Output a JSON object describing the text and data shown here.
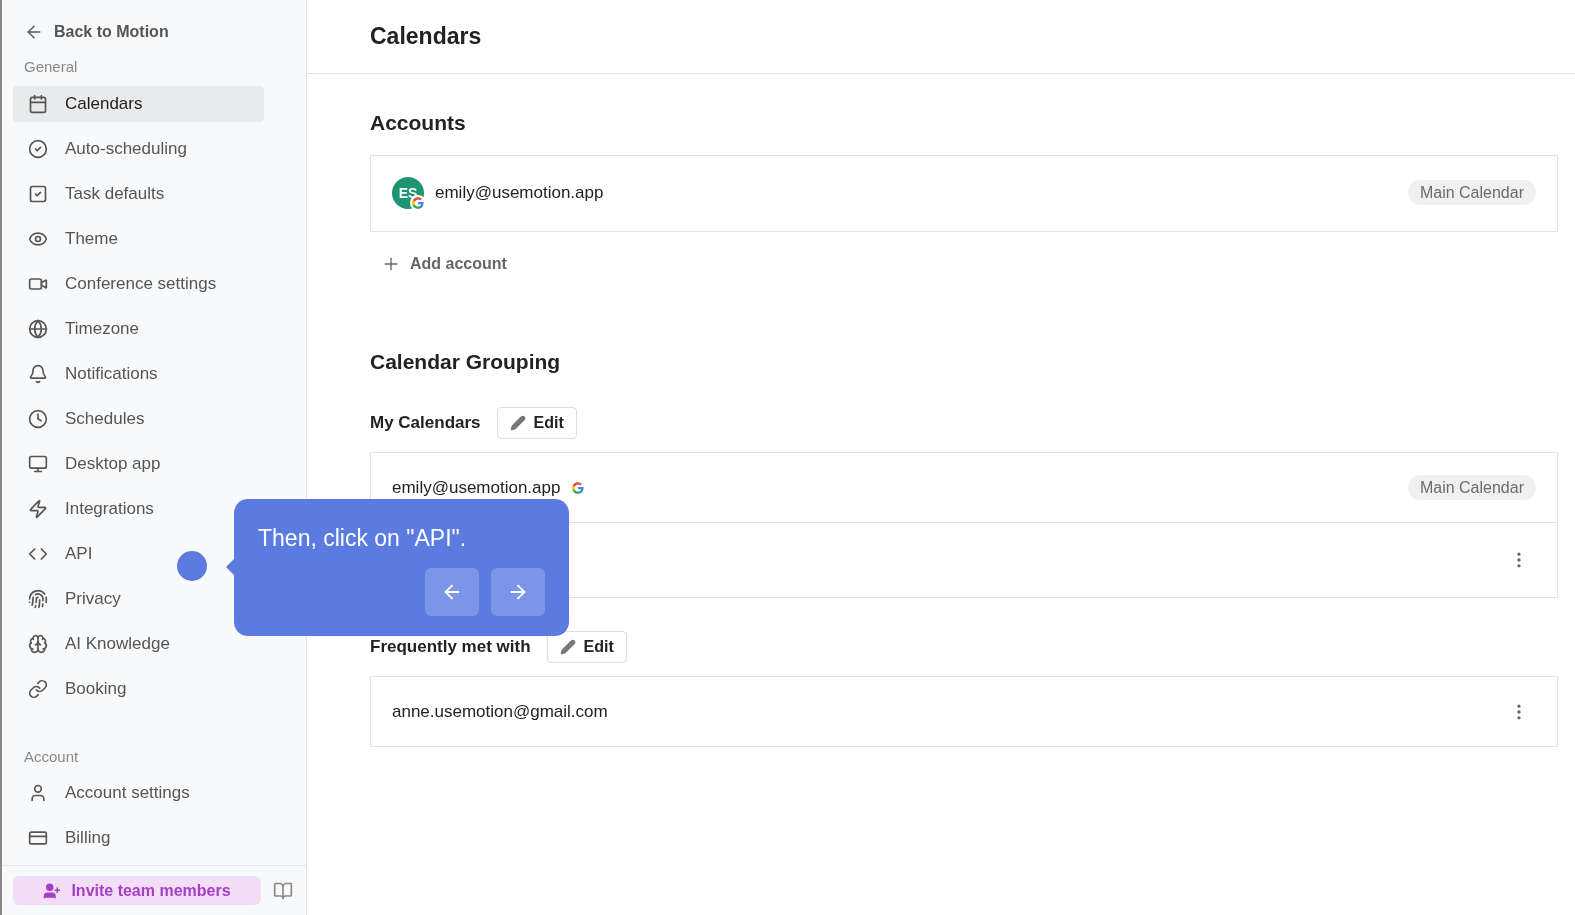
{
  "sidebar": {
    "back_link": "Back to Motion",
    "sections": [
      {
        "title": "General",
        "items": [
          {
            "label": "Calendars",
            "selected": true
          },
          {
            "label": "Auto-scheduling",
            "selected": false
          },
          {
            "label": "Task defaults",
            "selected": false
          },
          {
            "label": "Theme",
            "selected": false
          },
          {
            "label": "Conference settings",
            "selected": false
          },
          {
            "label": "Timezone",
            "selected": false
          },
          {
            "label": "Notifications",
            "selected": false
          },
          {
            "label": "Schedules",
            "selected": false
          },
          {
            "label": "Desktop app",
            "selected": false
          },
          {
            "label": "Integrations",
            "selected": false
          },
          {
            "label": "API",
            "selected": false
          },
          {
            "label": "Privacy",
            "selected": false
          },
          {
            "label": "AI Knowledge",
            "selected": false
          },
          {
            "label": "Booking",
            "selected": false
          }
        ]
      },
      {
        "title": "Account",
        "items": [
          {
            "label": "Account settings",
            "selected": false
          },
          {
            "label": "Billing",
            "selected": false
          }
        ]
      }
    ],
    "invite_button": "Invite team members"
  },
  "main": {
    "title": "Calendars",
    "accounts": {
      "heading": "Accounts",
      "items": [
        {
          "initials": "ES",
          "email": "emily@usemotion.app",
          "badge": "Main Calendar"
        }
      ],
      "add_button": "Add account"
    },
    "grouping": {
      "heading": "Calendar Grouping",
      "groups": [
        {
          "title": "My Calendars",
          "edit_button": "Edit",
          "rows": [
            {
              "email": "emily@usemotion.app",
              "google": true,
              "badge": "Main Calendar",
              "menu": false
            },
            {
              "menu": true
            }
          ]
        },
        {
          "title": "Frequently met with",
          "edit_button": "Edit",
          "rows": [
            {
              "email": "anne.usemotion@gmail.com",
              "google": false,
              "menu": true
            }
          ]
        }
      ]
    }
  },
  "tour": {
    "text": "Then, click on \"API\"."
  }
}
